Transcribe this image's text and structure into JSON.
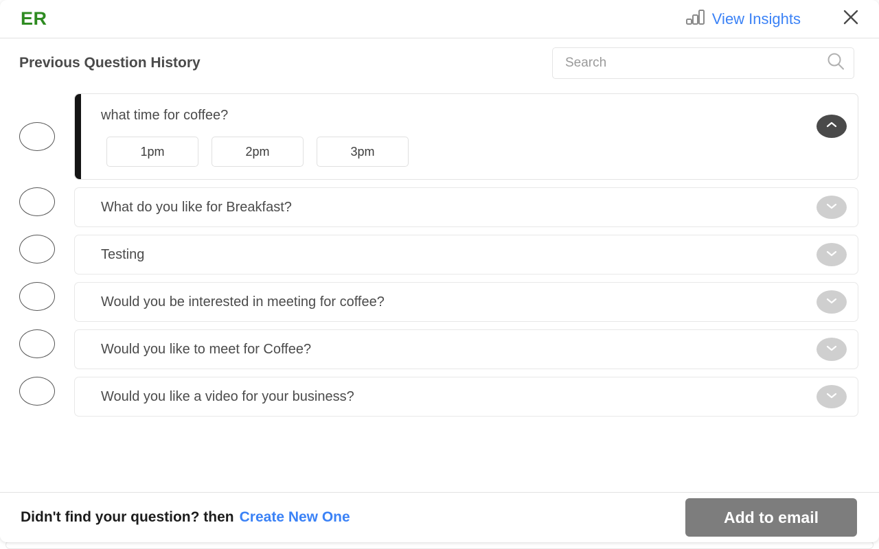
{
  "header": {
    "brand": "ER",
    "insights_label": "View Insights",
    "insights_icon": "bar-chart-icon",
    "close_icon": "close-icon",
    "accent_blue": "#3b82f6",
    "brand_green": "#2e8b21"
  },
  "subhead": {
    "title": "Previous Question History",
    "search": {
      "value": "",
      "placeholder": "Search",
      "icon": "search-icon"
    }
  },
  "questions": [
    {
      "text": "what time for coffee?",
      "expanded": true,
      "toggle_icon": "chevron-up-icon",
      "selected": false,
      "options": [
        "1pm",
        "2pm",
        "3pm"
      ]
    },
    {
      "text": "What do you like for Breakfast?",
      "expanded": false,
      "toggle_icon": "chevron-down-icon",
      "selected": false,
      "options": []
    },
    {
      "text": "Testing",
      "expanded": false,
      "toggle_icon": "chevron-down-icon",
      "selected": false,
      "options": []
    },
    {
      "text": "Would you be interested in meeting for coffee?",
      "expanded": false,
      "toggle_icon": "chevron-down-icon",
      "selected": false,
      "options": []
    },
    {
      "text": "Would you like to meet for Coffee?",
      "expanded": false,
      "toggle_icon": "chevron-down-icon",
      "selected": false,
      "options": []
    },
    {
      "text": "Would you like a video for your business?",
      "expanded": false,
      "toggle_icon": "chevron-down-icon",
      "selected": false,
      "options": []
    }
  ],
  "footer": {
    "prompt": "Didn't find your question? then",
    "link": "Create New One",
    "primary_button": "Add to email",
    "primary_button_color": "#7d7d7d"
  }
}
